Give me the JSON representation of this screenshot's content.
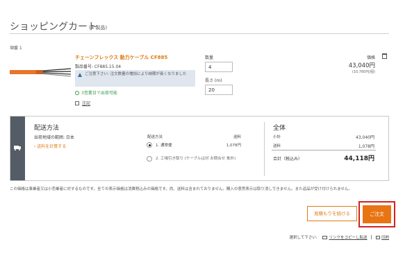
{
  "header": {
    "title": "ショッピングカート",
    "count": "(4 製品)"
  },
  "item": {
    "number_label": "項番 1",
    "name": "チェーンフレックス 動力ケーブル CF885",
    "code": "製品番号: CF885.15.04",
    "notice": "ご注意下さい: 注文数量の増加により納期が長くなりました",
    "ship_days": "3営業日で出荷可能",
    "note_link": "注記",
    "quantity_label": "数量",
    "quantity_value": "4",
    "length_label": "長さ (m)",
    "length_value": "20",
    "price_label": "価格",
    "price": "43,040円",
    "unit_price": "(10,760円/個)",
    "colors": {
      "cable_sheath": "#e8752a"
    }
  },
  "shipping": {
    "title": "配送方法",
    "region": "出荷地域の範囲: 日本",
    "calc_link": "› 送料を計算する",
    "method_label": "配送方法",
    "fee_label": "送料",
    "options": [
      {
        "label": "1. 通常便",
        "fee": "1,078円",
        "selected": true
      },
      {
        "label": "2. 工場引き取り (ケーブルは対 お問合せ 象外)",
        "fee": "",
        "selected": false
      }
    ]
  },
  "totals": {
    "title": "全体",
    "subtotal_label": "小計",
    "subtotal": "43,040円",
    "shipping_label": "送料",
    "shipping": "1,078円",
    "total_label": "合計（税込み）",
    "total": "44,118円"
  },
  "disclaimer": "この価格は事業者又は小売業者に対するものです。全ての表示価格は消費税込みの価格です。尚、送料は含まれておりません。購入の意思表示は取り消しできません。また返品が受け付けられません。",
  "actions": {
    "quote_label": "見積もりを続ける",
    "order_label": "ご注文"
  },
  "footer": {
    "select_label": "選択して下さい:",
    "copy_link": "リンクをコピーし転送",
    "print_link": "印刷"
  },
  "colors": {
    "accent": "#e07b13",
    "order_button": "#e87414",
    "highlight_frame": "#d42020",
    "ship_panel": "#545c66"
  }
}
